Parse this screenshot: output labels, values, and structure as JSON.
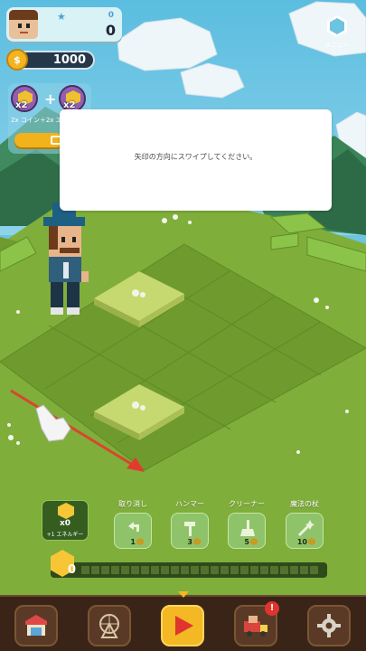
{
  "profile": {
    "level": "0",
    "xp": "0"
  },
  "coins": {
    "symbol": "$",
    "value": "1000"
  },
  "boost": {
    "multiplier_left": "x2",
    "multiplier_right": "x2",
    "plus": "+",
    "description": "2x コイン＋2x エネル"
  },
  "menu": {
    "label": "メニュー"
  },
  "dialog": {
    "message": "矢印の方向にスワイプしてください。"
  },
  "energy": {
    "count": "x0",
    "label": "+1 エネルギー",
    "bar_value": "0",
    "segments": 24
  },
  "tools": [
    {
      "label": "取り消し",
      "cost": "1"
    },
    {
      "label": "ハンマー",
      "cost": "3"
    },
    {
      "label": "クリーナー",
      "cost": "5"
    },
    {
      "label": "魔法の杖",
      "cost": "10"
    }
  ],
  "nav": {
    "items": [
      {
        "icon": "shop-icon"
      },
      {
        "icon": "ferris-wheel-icon"
      },
      {
        "icon": "play-icon"
      },
      {
        "icon": "delivery-truck-icon"
      },
      {
        "icon": "gear-icon"
      }
    ],
    "notification": "!"
  }
}
